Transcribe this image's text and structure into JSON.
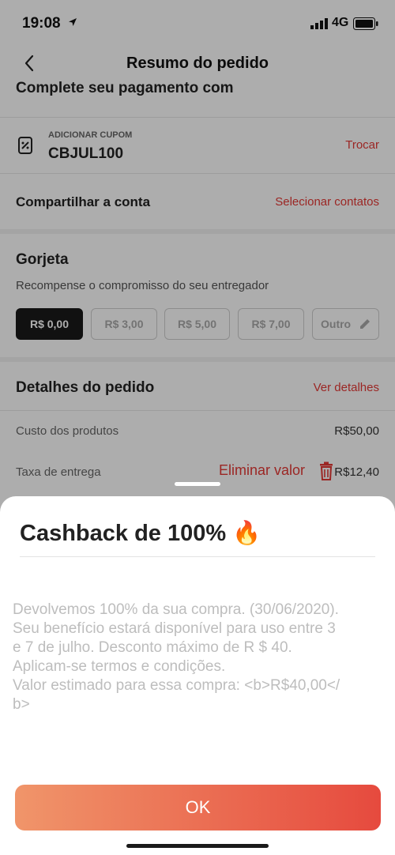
{
  "status_bar": {
    "time": "19:08",
    "network": "4G"
  },
  "header": {
    "title": "Resumo do pedido"
  },
  "payment": {
    "heading": "Complete seu pagamento com"
  },
  "coupon": {
    "label": "ADICIONAR CUPOM",
    "code": "CBJUL100",
    "action": "Trocar"
  },
  "share": {
    "label": "Compartilhar a conta",
    "action": "Selecionar contatos"
  },
  "tip": {
    "title": "Gorjeta",
    "subtitle": "Recompense o compromisso do seu entregador",
    "options": [
      "R$ 0,00",
      "R$ 3,00",
      "R$ 5,00",
      "R$ 7,00",
      "Outro"
    ],
    "selected": "R$ 0,00"
  },
  "details": {
    "title": "Detalhes do pedido",
    "action": "Ver  detalhes",
    "products_label": "Custo dos produtos",
    "products_value": "R$50,00",
    "delivery_label": "Taxa de entrega",
    "delivery_action": "Eliminar valor",
    "delivery_value": "R$12,40"
  },
  "sheet": {
    "title": "Cashback de 100% 🔥",
    "body": "Devolvemos 100% da sua compra. (30/06/2020).\nSeu benefício estará disponível para uso entre 3\ne 7 de julho. Desconto máximo de R $ 40.\nAplicam-se termos e condições.\nValor estimado para essa compra: <b>R$40,00</\nb>",
    "ok_label": "OK"
  },
  "colors": {
    "accent": "#e53935",
    "button_start": "#f0956a",
    "button_end": "#e64a3e",
    "selected_tip": "#1a1a1a"
  }
}
